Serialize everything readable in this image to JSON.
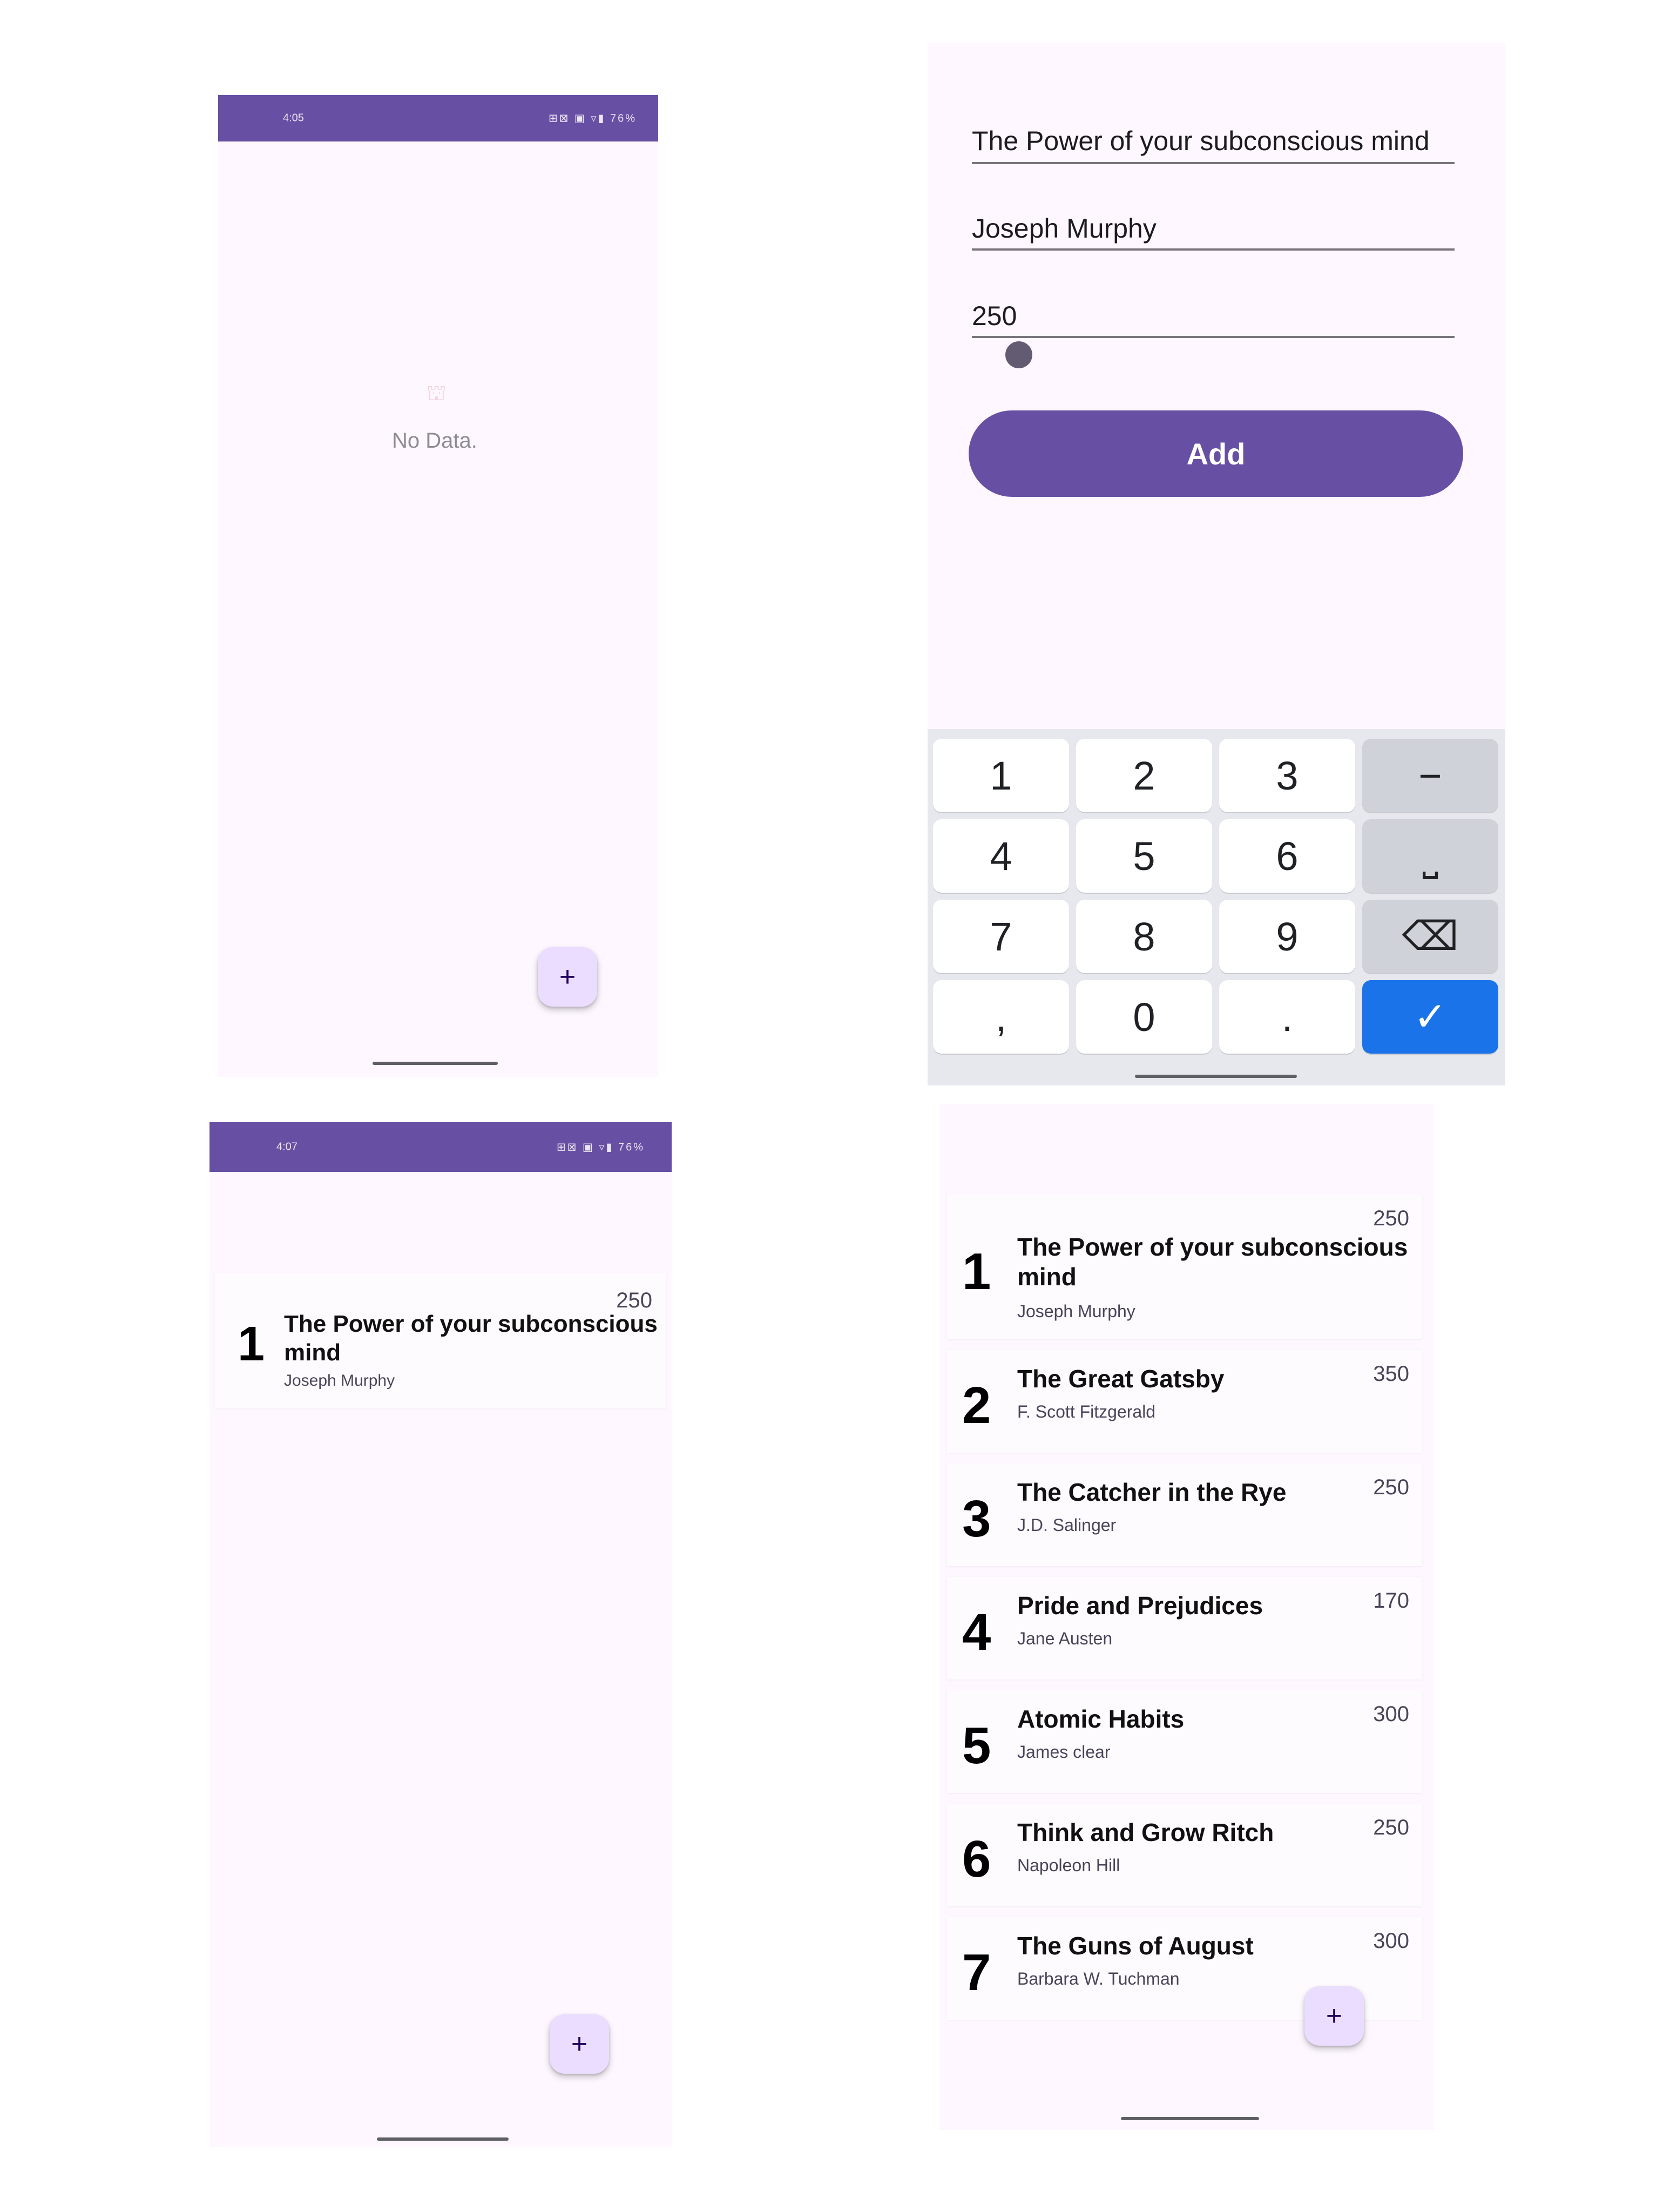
{
  "panel_empty": {
    "status_time": "4:05",
    "status_icons": "⊞⊠ ▣ ▿▮ 76%",
    "empty_text": "No Data.",
    "fab_label": "+"
  },
  "panel_form": {
    "title_value": "The Power of your subconscious mind",
    "author_value": "Joseph Murphy",
    "pages_value": "250",
    "slider_value": 250,
    "add_label": "Add",
    "keys": [
      {
        "label": "1",
        "kind": "num"
      },
      {
        "label": "2",
        "kind": "num"
      },
      {
        "label": "3",
        "kind": "num"
      },
      {
        "label": "−",
        "kind": "fn"
      },
      {
        "label": "4",
        "kind": "num"
      },
      {
        "label": "5",
        "kind": "num"
      },
      {
        "label": "6",
        "kind": "num"
      },
      {
        "label": "⎵",
        "kind": "fn"
      },
      {
        "label": "7",
        "kind": "num"
      },
      {
        "label": "8",
        "kind": "num"
      },
      {
        "label": "9",
        "kind": "num"
      },
      {
        "label": "⌫",
        "kind": "fn"
      },
      {
        "label": ",",
        "kind": "num"
      },
      {
        "label": "0",
        "kind": "num"
      },
      {
        "label": ".",
        "kind": "num"
      },
      {
        "label": "✓",
        "kind": "ok"
      }
    ]
  },
  "panel_one_book": {
    "status_time": "4:07",
    "status_icons": "⊞⊠ ▣ ▿▮ 76%",
    "fab_label": "+",
    "books": [
      {
        "num": "1",
        "title": "The Power of your subconscious mind",
        "author": "Joseph Murphy",
        "pages": "250"
      }
    ]
  },
  "panel_list": {
    "fab_label": "+",
    "books": [
      {
        "num": "1",
        "title": "The Power of your subconscious mind",
        "author": "Joseph Murphy",
        "pages": "250"
      },
      {
        "num": "2",
        "title": "The Great Gatsby",
        "author": "F. Scott Fitzgerald",
        "pages": "350"
      },
      {
        "num": "3",
        "title": "The Catcher in the Rye",
        "author": "J.D. Salinger",
        "pages": "250"
      },
      {
        "num": "4",
        "title": "Pride and Prejudices",
        "author": "Jane Austen",
        "pages": "170"
      },
      {
        "num": "5",
        "title": "Atomic Habits",
        "author": "James clear",
        "pages": "300"
      },
      {
        "num": "6",
        "title": "Think and Grow Ritch",
        "author": "Napoleon Hill",
        "pages": "250"
      },
      {
        "num": "7",
        "title": "The Guns of August",
        "author": "Barbara W. Tuchman",
        "pages": "300"
      }
    ]
  },
  "colors": {
    "primary": "#6750a4",
    "background": "#fef7ff",
    "fab": "#eaddff",
    "keyboard_confirm": "#1a73e8"
  }
}
